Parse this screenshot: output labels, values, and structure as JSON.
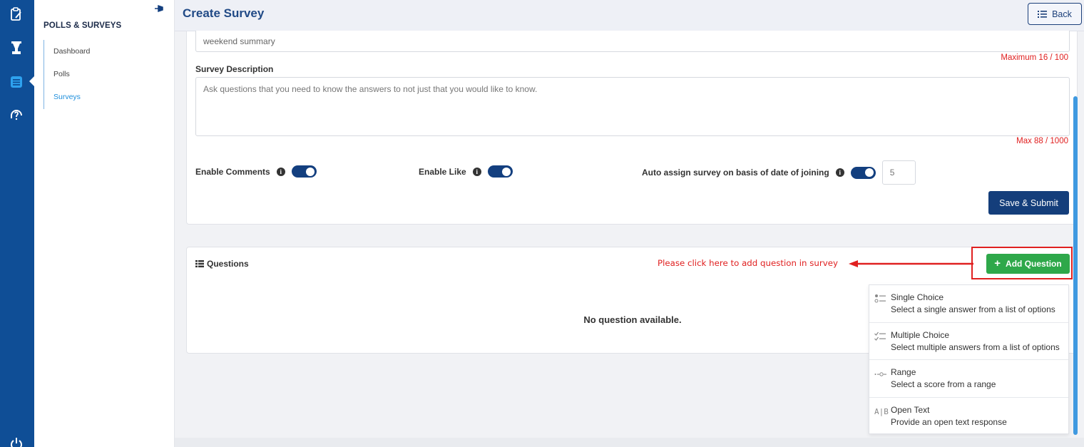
{
  "app": {
    "sidebar_title": "POLLS & SURVEYS",
    "nav": [
      {
        "label": "Dashboard",
        "active": false
      },
      {
        "label": "Polls",
        "active": false
      },
      {
        "label": "Surveys",
        "active": true
      }
    ],
    "rail_icons": [
      "clipboard-icon",
      "trophy-icon",
      "survey-list-icon",
      "help-icon",
      "power-icon"
    ]
  },
  "header": {
    "title": "Create Survey",
    "back_label": "Back"
  },
  "form": {
    "title_value": "weekend summary",
    "title_counter": "Maximum 16 / 100",
    "description_label": "Survey Description",
    "description_value": "Ask questions that you need to know the answers to not just that you would like to know.",
    "description_counter": "Max 88 / 1000",
    "enable_comments_label": "Enable Comments",
    "enable_comments": true,
    "enable_like_label": "Enable Like",
    "enable_like": true,
    "auto_assign_label": "Auto assign survey on basis of date of joining",
    "auto_assign": true,
    "auto_assign_days": "5",
    "save_label": "Save & Submit"
  },
  "questions": {
    "title": "Questions",
    "empty_text": "No question available.",
    "annotation": "Please click here to add question in survey",
    "add_label": "Add Question",
    "menu": [
      {
        "icon": "single-choice-icon",
        "title": "Single Choice",
        "desc": "Select a single answer from a list of options"
      },
      {
        "icon": "multiple-choice-icon",
        "title": "Multiple Choice",
        "desc": "Select multiple answers from a list of options"
      },
      {
        "icon": "range-icon",
        "title": "Range",
        "desc": "Select a score from a range"
      },
      {
        "icon": "open-text-icon",
        "title": "Open Text",
        "desc": "Provide an open text response"
      }
    ]
  },
  "colors": {
    "rail": "#0f4e96",
    "primary": "#143e7b",
    "success": "#2ea84a",
    "danger": "#e02020",
    "link": "#1f8fdc"
  }
}
